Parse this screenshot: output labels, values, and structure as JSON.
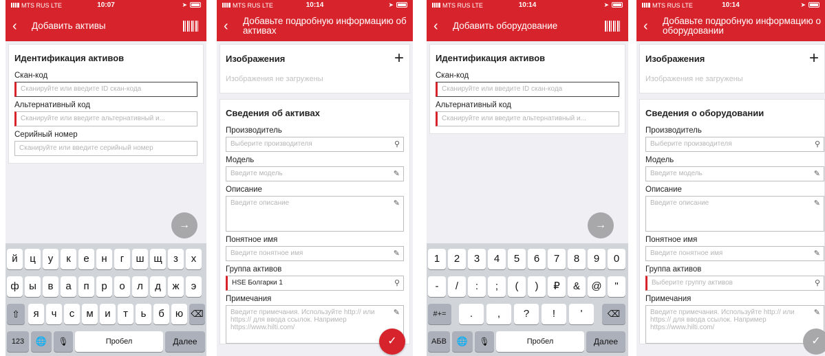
{
  "colors": {
    "accent": "#d7232b",
    "background": "#efeff4"
  },
  "status": {
    "carrier": "MTS RUS  LTE"
  },
  "screens": [
    {
      "time": "10:07",
      "title": "Добавить активы",
      "section_title": "Идентификация активов",
      "fields": [
        {
          "label": "Скан-код",
          "placeholder": "Сканируйте или введите ID скан-кода"
        },
        {
          "label": "Альтернативный код",
          "placeholder": "Сканируйте или введите альтернативный и..."
        },
        {
          "label": "Серийный номер",
          "placeholder": "Сканируйте или введите серийный номер"
        }
      ]
    },
    {
      "time": "10:14",
      "title": "Добавьте подробную информацию об активах",
      "images_title": "Изображения",
      "images_empty": "Изображения не загружены",
      "section_title": "Сведения об активах",
      "fields": [
        {
          "label": "Производитель",
          "placeholder": "Выберите производителя"
        },
        {
          "label": "Модель",
          "placeholder": "Введите модель"
        },
        {
          "label": "Описание",
          "placeholder": "Введите описание"
        },
        {
          "label": "Понятное имя",
          "placeholder": "Введите понятное имя"
        },
        {
          "label": "Группа активов",
          "value": "HSE Болгарки 1"
        },
        {
          "label": "Примечания",
          "placeholder": "Введите примечания. Используйте http:// или https:// для ввода ссылок. Например https://www.hilti.com/"
        }
      ]
    },
    {
      "time": "10:14",
      "title": "Добавить оборудование",
      "section_title": "Идентификация активов",
      "fields": [
        {
          "label": "Скан-код",
          "placeholder": "Сканируйте или введите ID скан-кода"
        },
        {
          "label": "Альтернативный код",
          "placeholder": "Сканируйте или введите альтернативный и..."
        }
      ]
    },
    {
      "time": "10:14",
      "title": "Добавьте подробную информацию о оборудовании",
      "images_title": "Изображения",
      "images_empty": "Изображения не загружены",
      "section_title": "Сведения о оборудовании",
      "fields": [
        {
          "label": "Производитель",
          "placeholder": "Выберите производителя"
        },
        {
          "label": "Модель",
          "placeholder": "Введите модель"
        },
        {
          "label": "Описание",
          "placeholder": "Введите описание"
        },
        {
          "label": "Понятное имя",
          "placeholder": "Введите понятное имя"
        },
        {
          "label": "Группа активов",
          "placeholder": "Выберите группу активов"
        },
        {
          "label": "Примечания",
          "placeholder": "Введите примечания. Используйте http:// или https:// для ввода ссылок. Например https://www.hilti.com/"
        }
      ]
    }
  ],
  "keyboard_ru": {
    "row1": [
      "й",
      "ц",
      "у",
      "к",
      "е",
      "н",
      "г",
      "ш",
      "щ",
      "з",
      "х"
    ],
    "row2": [
      "ф",
      "ы",
      "в",
      "а",
      "п",
      "р",
      "о",
      "л",
      "д",
      "ж",
      "э"
    ],
    "row3": [
      "я",
      "ч",
      "с",
      "м",
      "и",
      "т",
      "ь",
      "б",
      "ю"
    ],
    "shift": "⇧",
    "backspace": "⌫",
    "numbers": "123",
    "globe": "🌐",
    "mic": "🎙",
    "space": "Пробел",
    "return": "Далее"
  },
  "keyboard_num": {
    "row1": [
      "1",
      "2",
      "3",
      "4",
      "5",
      "6",
      "7",
      "8",
      "9",
      "0"
    ],
    "row2": [
      "-",
      "/",
      ":",
      ";",
      "(",
      ")",
      "₽",
      "&",
      "@",
      "\""
    ],
    "row3": [
      ".",
      ",",
      "?",
      "!",
      "'"
    ],
    "symbols": "#+=",
    "backspace": "⌫",
    "letters": "АБВ",
    "globe": "🌐",
    "mic": "🎙",
    "space": "Пробел",
    "return": "Далее"
  }
}
